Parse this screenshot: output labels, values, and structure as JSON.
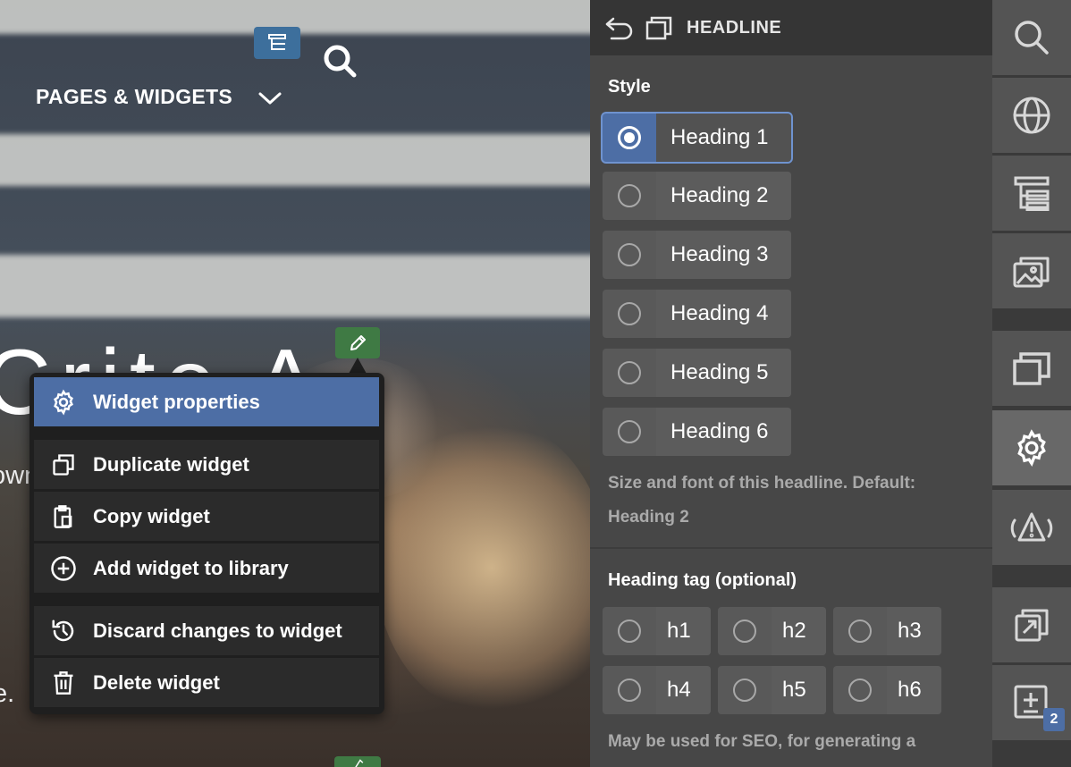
{
  "nav": {
    "label": "PAGES & WIDGETS"
  },
  "hero": {
    "title": "Crite A",
    "subtitle": "own website.",
    "tail": "e."
  },
  "context_menu": {
    "items": [
      {
        "label": "Widget properties",
        "icon": "gear-icon",
        "active": true
      },
      {
        "label": "Duplicate widget",
        "icon": "duplicate-icon"
      },
      {
        "label": "Copy widget",
        "icon": "clipboard-icon"
      },
      {
        "label": "Add widget to library",
        "icon": "plus-circle-icon"
      },
      {
        "label": "Discard changes to widget",
        "icon": "history-icon"
      },
      {
        "label": "Delete widget",
        "icon": "trash-icon"
      }
    ]
  },
  "panel": {
    "title": "HEADLINE",
    "style_label": "Style",
    "styles": [
      "Heading 1",
      "Heading 2",
      "Heading 3",
      "Heading 4",
      "Heading 5",
      "Heading 6"
    ],
    "selected_style": "Heading 1",
    "style_hint": "Size and font of this headline. Default: Heading 2",
    "tag_label": "Heading tag (optional)",
    "tags": [
      "h1",
      "h2",
      "h3",
      "h4",
      "h5",
      "h6"
    ],
    "tag_hint": "May be used for SEO, for generating a"
  },
  "toolbar": {
    "items": [
      "search-icon",
      "globe-icon",
      "page-tree-icon",
      "images-icon",
      "window-icon",
      "gear-icon",
      "warning-icon",
      "publish-icon",
      "add-widget-icon"
    ],
    "active": "gear-icon",
    "badge": "2"
  },
  "colors": {
    "accent": "#4d6ea5",
    "edit_green": "#3f7a44",
    "panel_bg": "#474747",
    "toolbar_bg": "#545454"
  }
}
